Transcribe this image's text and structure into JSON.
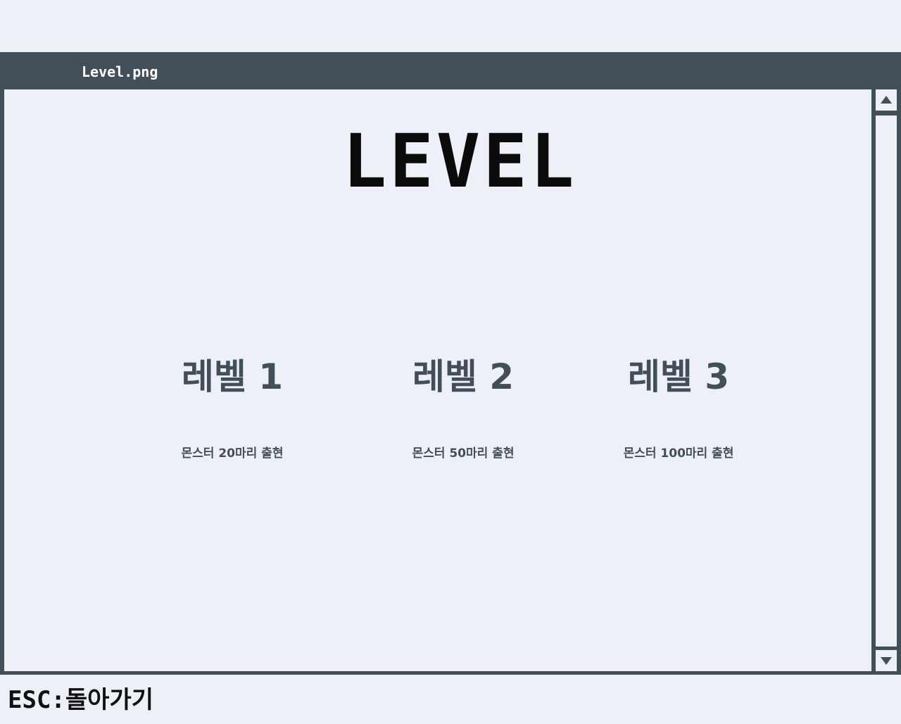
{
  "window": {
    "title": "Level.png"
  },
  "screen": {
    "heading": "LEVEL",
    "levels": [
      {
        "label": "레벨 1",
        "description": "몬스터 20마리 출현"
      },
      {
        "label": "레벨 2",
        "description": "몬스터 50마리 출현"
      },
      {
        "label": "레벨 3",
        "description": "몬스터 100마리 출현"
      }
    ]
  },
  "footer": {
    "esc_hint": "ESC:돌아가기"
  },
  "icons": {
    "scroll_up": "triangle-up-icon",
    "scroll_down": "triangle-down-icon"
  },
  "colors": {
    "background": "#edf1f7",
    "frame": "#434f58",
    "heading": "#0b0b0b",
    "level_text": "#434f58"
  }
}
